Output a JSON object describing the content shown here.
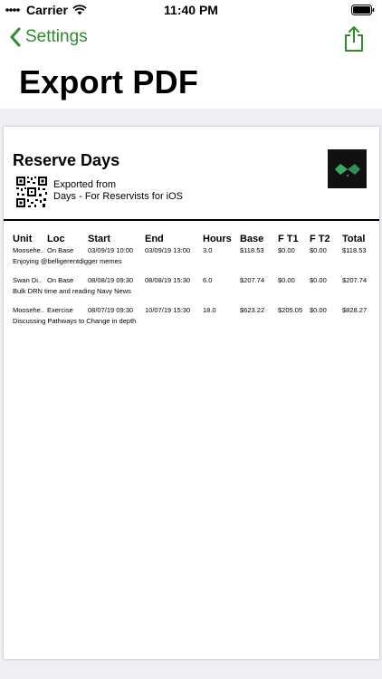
{
  "status": {
    "carrier": "Carrier",
    "time": "11:40 PM"
  },
  "nav": {
    "back_label": "Settings",
    "title": "Export PDF"
  },
  "doc": {
    "title": "Reserve Days",
    "exported_line1": "Exported from",
    "exported_line2": "Days - For Reservists for iOS"
  },
  "table": {
    "headers": [
      "Unit",
      "Loc",
      "Start",
      "End",
      "Hours",
      "Base",
      "F T1",
      "F T2",
      "Total"
    ],
    "rows": [
      {
        "cells": [
          "Moosehe..",
          "On Base",
          "03/09/19 10:00",
          "03/09/19 13:00",
          "3.0",
          "$118.53",
          "$0.00",
          "$0.00",
          "$118.53"
        ],
        "description": "Enjoying @belligerentdigger memes"
      },
      {
        "cells": [
          "Swan Di..",
          "On Base",
          "08/08/19 09:30",
          "08/08/19 15:30",
          "6.0",
          "$207.74",
          "$0.00",
          "$0.00",
          "$207.74"
        ],
        "description": "Bulk DRN time and reading Navy News"
      },
      {
        "cells": [
          "Moosehe..",
          "Exercise",
          "08/07/19 09:30",
          "10/07/19 15:30",
          "18.0",
          "$623.22",
          "$205.05",
          "$0.00",
          "$828.27"
        ],
        "description": "Discussing Pathways to Change in depth"
      }
    ]
  },
  "colors": {
    "accent": "#2e8b2e",
    "page_bg": "#efeff4"
  },
  "icons": {
    "back": "chevron-left-icon",
    "share": "share-icon",
    "wifi": "wifi-icon",
    "battery": "battery-icon"
  }
}
